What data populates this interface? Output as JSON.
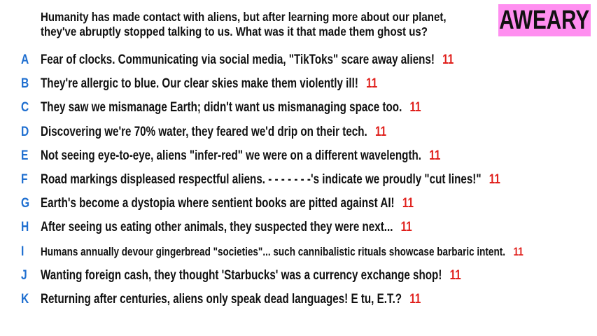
{
  "prompt": {
    "line1": "Humanity has made contact with aliens, but after learning more about our planet,",
    "line2": "they've abruptly stopped talking to us. What was it that made them ghost us?"
  },
  "logo": {
    "text": "AWEARY",
    "color": "#ff8ff0"
  },
  "colors": {
    "letter": "#1f6fd0",
    "score": "#e0201c"
  },
  "answers": [
    {
      "letter": "A",
      "text": "Fear of clocks. Communicating via social media, \"TikToks\" scare away aliens!",
      "score": "11"
    },
    {
      "letter": "B",
      "text": "They're allergic to blue. Our clear skies make them violently ill!",
      "score": "11"
    },
    {
      "letter": "C",
      "text": "They saw we mismanage Earth; didn't want us mismanaging space too.",
      "score": "11"
    },
    {
      "letter": "D",
      "text": "Discovering we're 70% water, they feared we'd drip on their tech.",
      "score": "11"
    },
    {
      "letter": "E",
      "text": "Not seeing eye-to-eye, aliens \"infer-red\" we were on a different wavelength.",
      "score": "11"
    },
    {
      "letter": "F",
      "text": "Road markings displeased respectful aliens. - - - - - - -'s indicate we proudly \"cut lines!\"",
      "score": "11"
    },
    {
      "letter": "G",
      "text": "Earth's become a dystopia where sentient books are pitted against AI!",
      "score": "11"
    },
    {
      "letter": "H",
      "text": "After seeing us eating other animals, they suspected they were next...",
      "score": "11"
    },
    {
      "letter": "I",
      "text": "Humans annually devour gingerbread \"societies\"... such cannibalistic rituals showcase barbaric intent.",
      "score": "11"
    },
    {
      "letter": "J",
      "text": "Wanting foreign cash, they thought 'Starbucks' was a currency exchange shop!",
      "score": "11"
    },
    {
      "letter": "K",
      "text": "Returning after centuries, aliens only speak dead languages! E tu, E.T.?",
      "score": "11"
    }
  ]
}
